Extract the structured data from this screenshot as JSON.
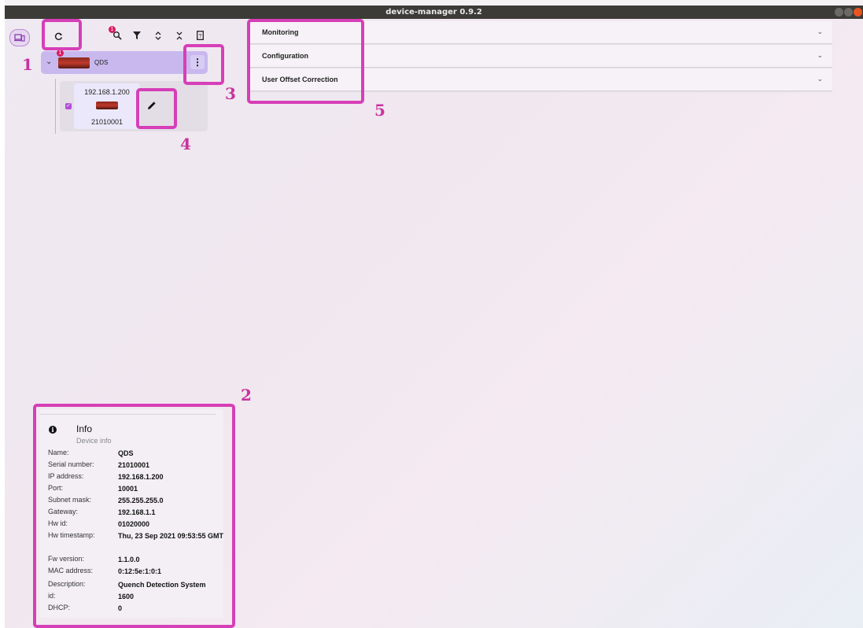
{
  "window": {
    "title": "device-manager 0.9.2"
  },
  "rail": {
    "device_icon": "devices-icon"
  },
  "toolbar": {
    "refresh_icon": "refresh-icon",
    "search_badge": "1",
    "icons": [
      "search-icon",
      "filter-icon",
      "expand-all-icon",
      "collapse-all-icon",
      "help-icon"
    ]
  },
  "tree": {
    "node": {
      "name": "QDS",
      "badge": "1",
      "expand_glyph": "⌄",
      "more_glyph": "⋮"
    },
    "child": {
      "ip": "192.168.1.200",
      "serial": "21010001",
      "check": "✓",
      "edit_glyph": "✎"
    }
  },
  "accordions": [
    {
      "label": "Monitoring"
    },
    {
      "label": "Configuration"
    },
    {
      "label": "User Offset Correction"
    }
  ],
  "info": {
    "title": "Info",
    "subtitle": "Device info",
    "rows": [
      {
        "k": "Name:",
        "v": "QDS"
      },
      {
        "k": "Serial number:",
        "v": "21010001"
      },
      {
        "k": "IP address:",
        "v": "192.168.1.200"
      },
      {
        "k": "Port:",
        "v": "10001"
      },
      {
        "k": "Subnet mask:",
        "v": "255.255.255.0"
      },
      {
        "k": "Gateway:",
        "v": "192.168.1.1"
      },
      {
        "k": "Hw id:",
        "v": "01020000"
      },
      {
        "k": "Hw timestamp:",
        "v": "Thu, 23 Sep 2021 09:53:55 GMT"
      },
      {
        "k": "Fw version:",
        "v": "1.1.0.0"
      },
      {
        "k": "MAC address:",
        "v": "0:12:5e:1:0:1"
      },
      {
        "k": "Description:",
        "v": "Quench Detection System"
      },
      {
        "k": "id:",
        "v": "1600"
      },
      {
        "k": "DHCP:",
        "v": "0"
      }
    ]
  },
  "annotations": {
    "n1": "1",
    "n2": "2",
    "n3": "3",
    "n4": "4",
    "n5": "5",
    "color": "#d63fb7"
  }
}
